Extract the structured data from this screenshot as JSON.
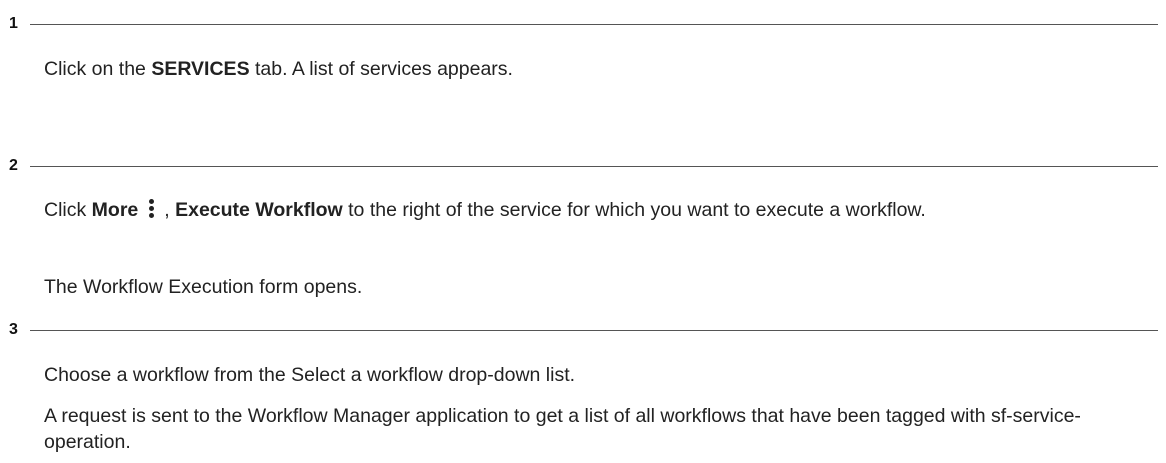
{
  "steps": [
    {
      "number": "1",
      "p1": {
        "pre": "Click on the ",
        "bold": "SERVICES",
        "post": " tab. A list of services appears."
      }
    },
    {
      "number": "2",
      "p1": {
        "pre": "Click ",
        "bold1": "More",
        "icon": "more-vertical-icon",
        "sep": ", ",
        "bold2": "Execute Workflow",
        "post": " to the right of the service for which you want to execute a workflow."
      },
      "p2": "The Workflow Execution form opens."
    },
    {
      "number": "3",
      "p1": "Choose a workflow from the Select a workflow drop-down list.",
      "p2": "A request is sent to the Workflow Manager application to get a list of all workflows that have been tagged with sf-service-operation."
    }
  ]
}
